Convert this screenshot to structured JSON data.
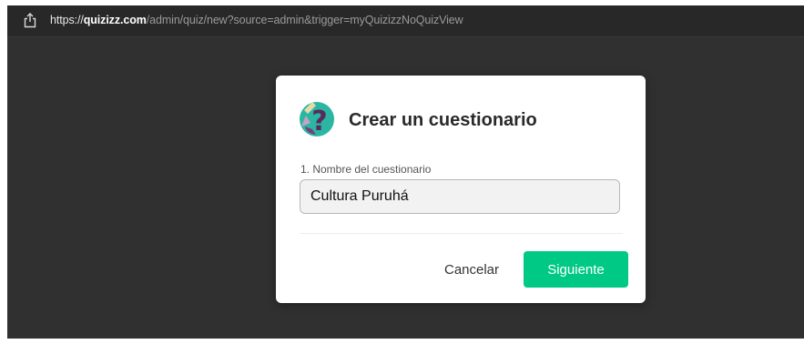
{
  "browser": {
    "url_scheme": "https://",
    "url_domain": "quizizz.com",
    "url_path": "/admin/quiz/new?source=admin&trigger=myQuizizzNoQuizView"
  },
  "dialog": {
    "title": "Crear un cuestionario",
    "field_label": "1. Nombre del cuestionario",
    "name_value": "Cultura Puruhá",
    "cancel_label": "Cancelar",
    "next_label": "Siguiente",
    "logo_icon": "quiz-question-mark-icon"
  },
  "colors": {
    "backdrop": "#303030",
    "primary_button": "#00c985",
    "logo_circle": "#2bb6a3",
    "logo_question": "#5a2a5c"
  }
}
